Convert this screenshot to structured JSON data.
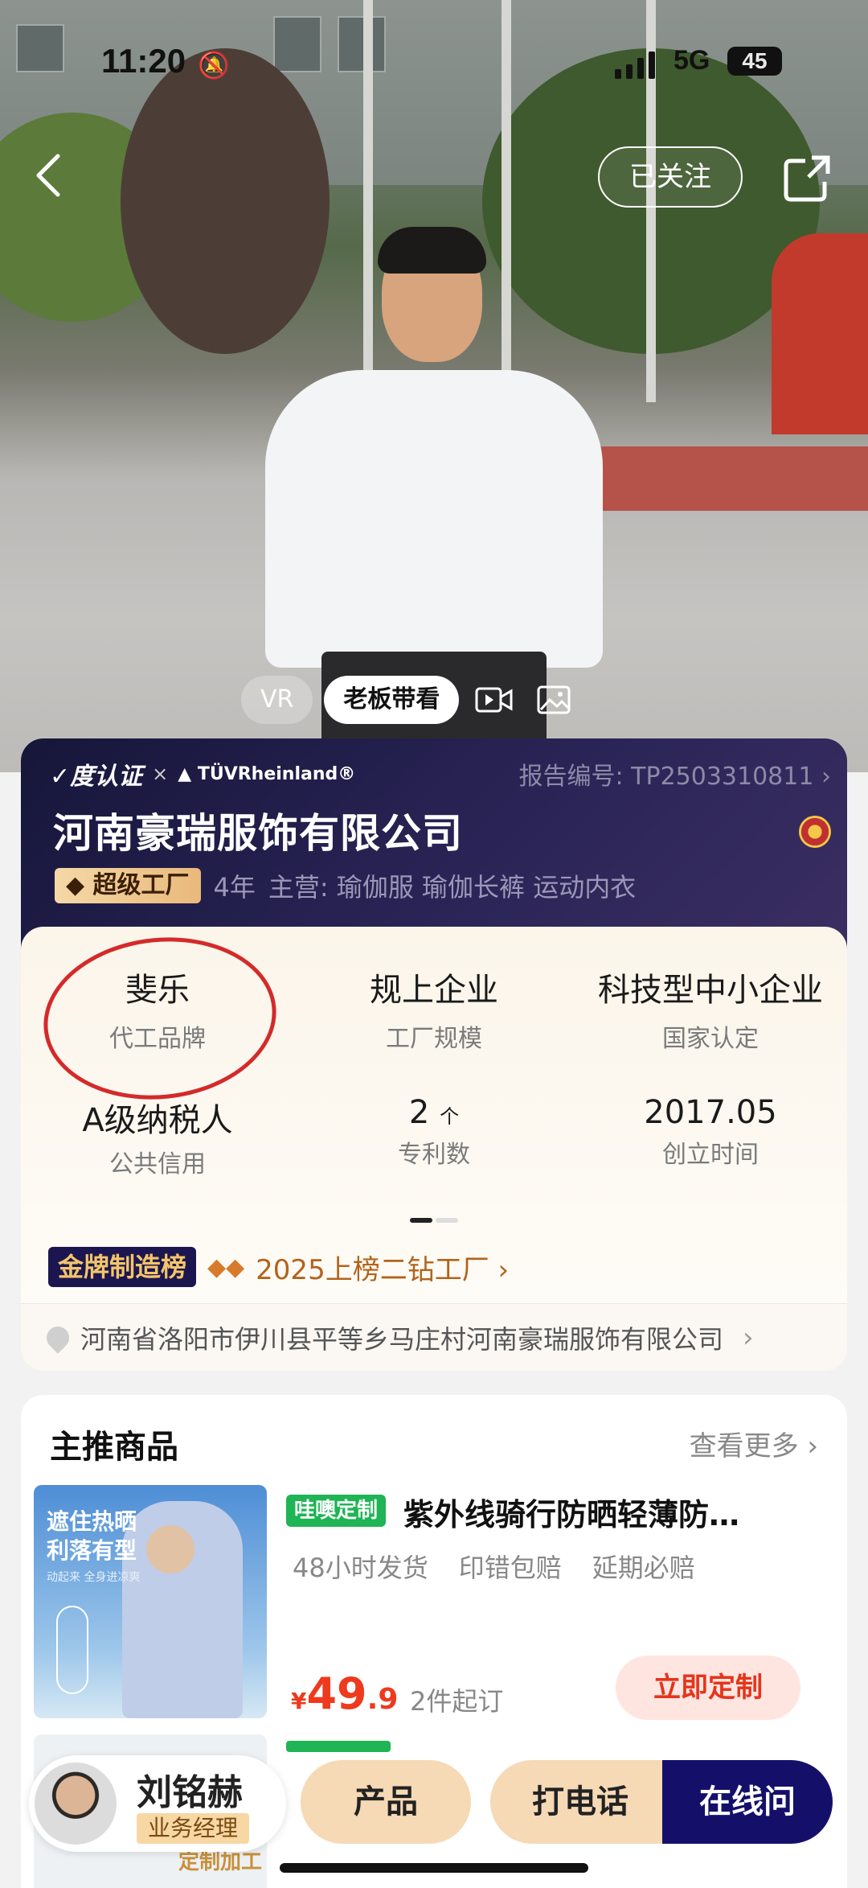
{
  "status_bar": {
    "time": "11:20",
    "network": "5G",
    "battery": "45"
  },
  "header": {
    "follow_label": "已关注"
  },
  "media_tabs": [
    {
      "label": "VR"
    },
    {
      "label": "老板带看"
    }
  ],
  "company": {
    "cert_brand": "度认证",
    "cert_x": "×",
    "cert_partner": "TÜVRheinland®",
    "report_no": "报告编号: TP2503310811",
    "name": "河南豪瑞服饰有限公司",
    "badge": "超级工厂",
    "years": "4年",
    "main_business": "主营:  瑜伽服 瑜伽长裤 运动内衣"
  },
  "stats": [
    {
      "value": "斐乐",
      "label": "代工品牌"
    },
    {
      "value": "规上企业",
      "label": "工厂规模"
    },
    {
      "value": "科技型中小企业",
      "label": "国家认定"
    },
    {
      "value": "A级纳税人",
      "label": "公共信用"
    },
    {
      "value": "2",
      "unit": "个",
      "label": "专利数"
    },
    {
      "value": "2017.05",
      "label": "创立时间"
    }
  ],
  "ranking": {
    "badge": "金牌制造榜",
    "diamonds": "◆◆",
    "text": "2025上榜二钻工厂 ›"
  },
  "address": {
    "text": "河南省洛阳市伊川县平等乡马庄村河南豪瑞服饰有限公司",
    "arrow": "›"
  },
  "products_section": {
    "title": "主推商品",
    "more": "查看更多 ›",
    "items": [
      {
        "image_text_1": "遮住热晒",
        "image_text_2": "利落有型",
        "image_text_3": "动起来 全身进凉爽",
        "tag": "哇噢定制",
        "name": "紫外线骑行防晒轻薄防…",
        "features": [
          "48小时发货",
          "印错包赔",
          "延期必赔"
        ],
        "price_currency": "¥",
        "price_int": "49",
        "price_dec": ".9",
        "moq": "2件起订",
        "cta": "立即定制"
      },
      {
        "image_tag": "定制加工"
      }
    ]
  },
  "bottom_bar": {
    "rep_name": "刘铭赫",
    "rep_role": "业务经理",
    "products_label": "产品",
    "call_label": "打电话",
    "chat_label": "在线问"
  }
}
